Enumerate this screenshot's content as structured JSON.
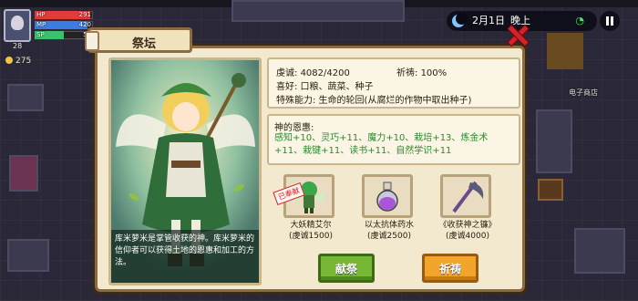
{
  "hud": {
    "hp": {
      "label": "HP",
      "value": "291",
      "fraction": 0.95
    },
    "mp": {
      "label": "MP",
      "value": "420",
      "fraction": 0.9
    },
    "sp": {
      "label": "SP",
      "value": "51",
      "fraction": 0.5
    },
    "level": "28",
    "coins": "275"
  },
  "topbar": {
    "date": "2月1日",
    "time": "晚上"
  },
  "colors": {
    "hp": "#e23b3b",
    "mp": "#3b7be2",
    "sp": "#39c16b",
    "offer_button": "#77b733",
    "pray_button": "#f2a52b",
    "close": "#d8202a",
    "bless_text": "#2a8a2a"
  },
  "panel": {
    "title": "祭坛",
    "portrait_description": "库米萝米是掌管收获的神。库米萝米的信仰者可以获得土地的恩惠和加工的方法。",
    "info": {
      "piety_label": "虔诚: ",
      "piety_value": "4082/4200",
      "faith_label": "祈祷: ",
      "faith_value": "100%",
      "likes": "喜好: 口粮、蔬菜、种子",
      "ability": "特殊能力: 生命的轮回(从腐烂的作物中取出种子)"
    },
    "blessings": {
      "title": "神的恩惠:",
      "text": "感知+10、灵巧+11、魔力+10、栽培+13、炼金术+11、栽键+11、读书+11、自然学识+11"
    },
    "offerings": [
      {
        "name": "大妖精艾尔",
        "cost": "(虔诚1500)",
        "icon": "fairy-icon",
        "offered": true,
        "stamp": "已奉献",
        "prefix": "\u0000\u0000",
        "prefix_label": ""
      },
      {
        "name": "以太抗体药水",
        "cost": "(虔诚2500)",
        "icon": "potion-icon",
        "offered": false
      },
      {
        "name": "《收获神之镰》",
        "cost": "(虔诚4000)",
        "icon": "scythe-icon",
        "offered": false
      }
    ],
    "buttons": {
      "offer": "献祭",
      "pray": "祈祷"
    }
  },
  "world": {
    "shop_sign": "电子商店"
  }
}
